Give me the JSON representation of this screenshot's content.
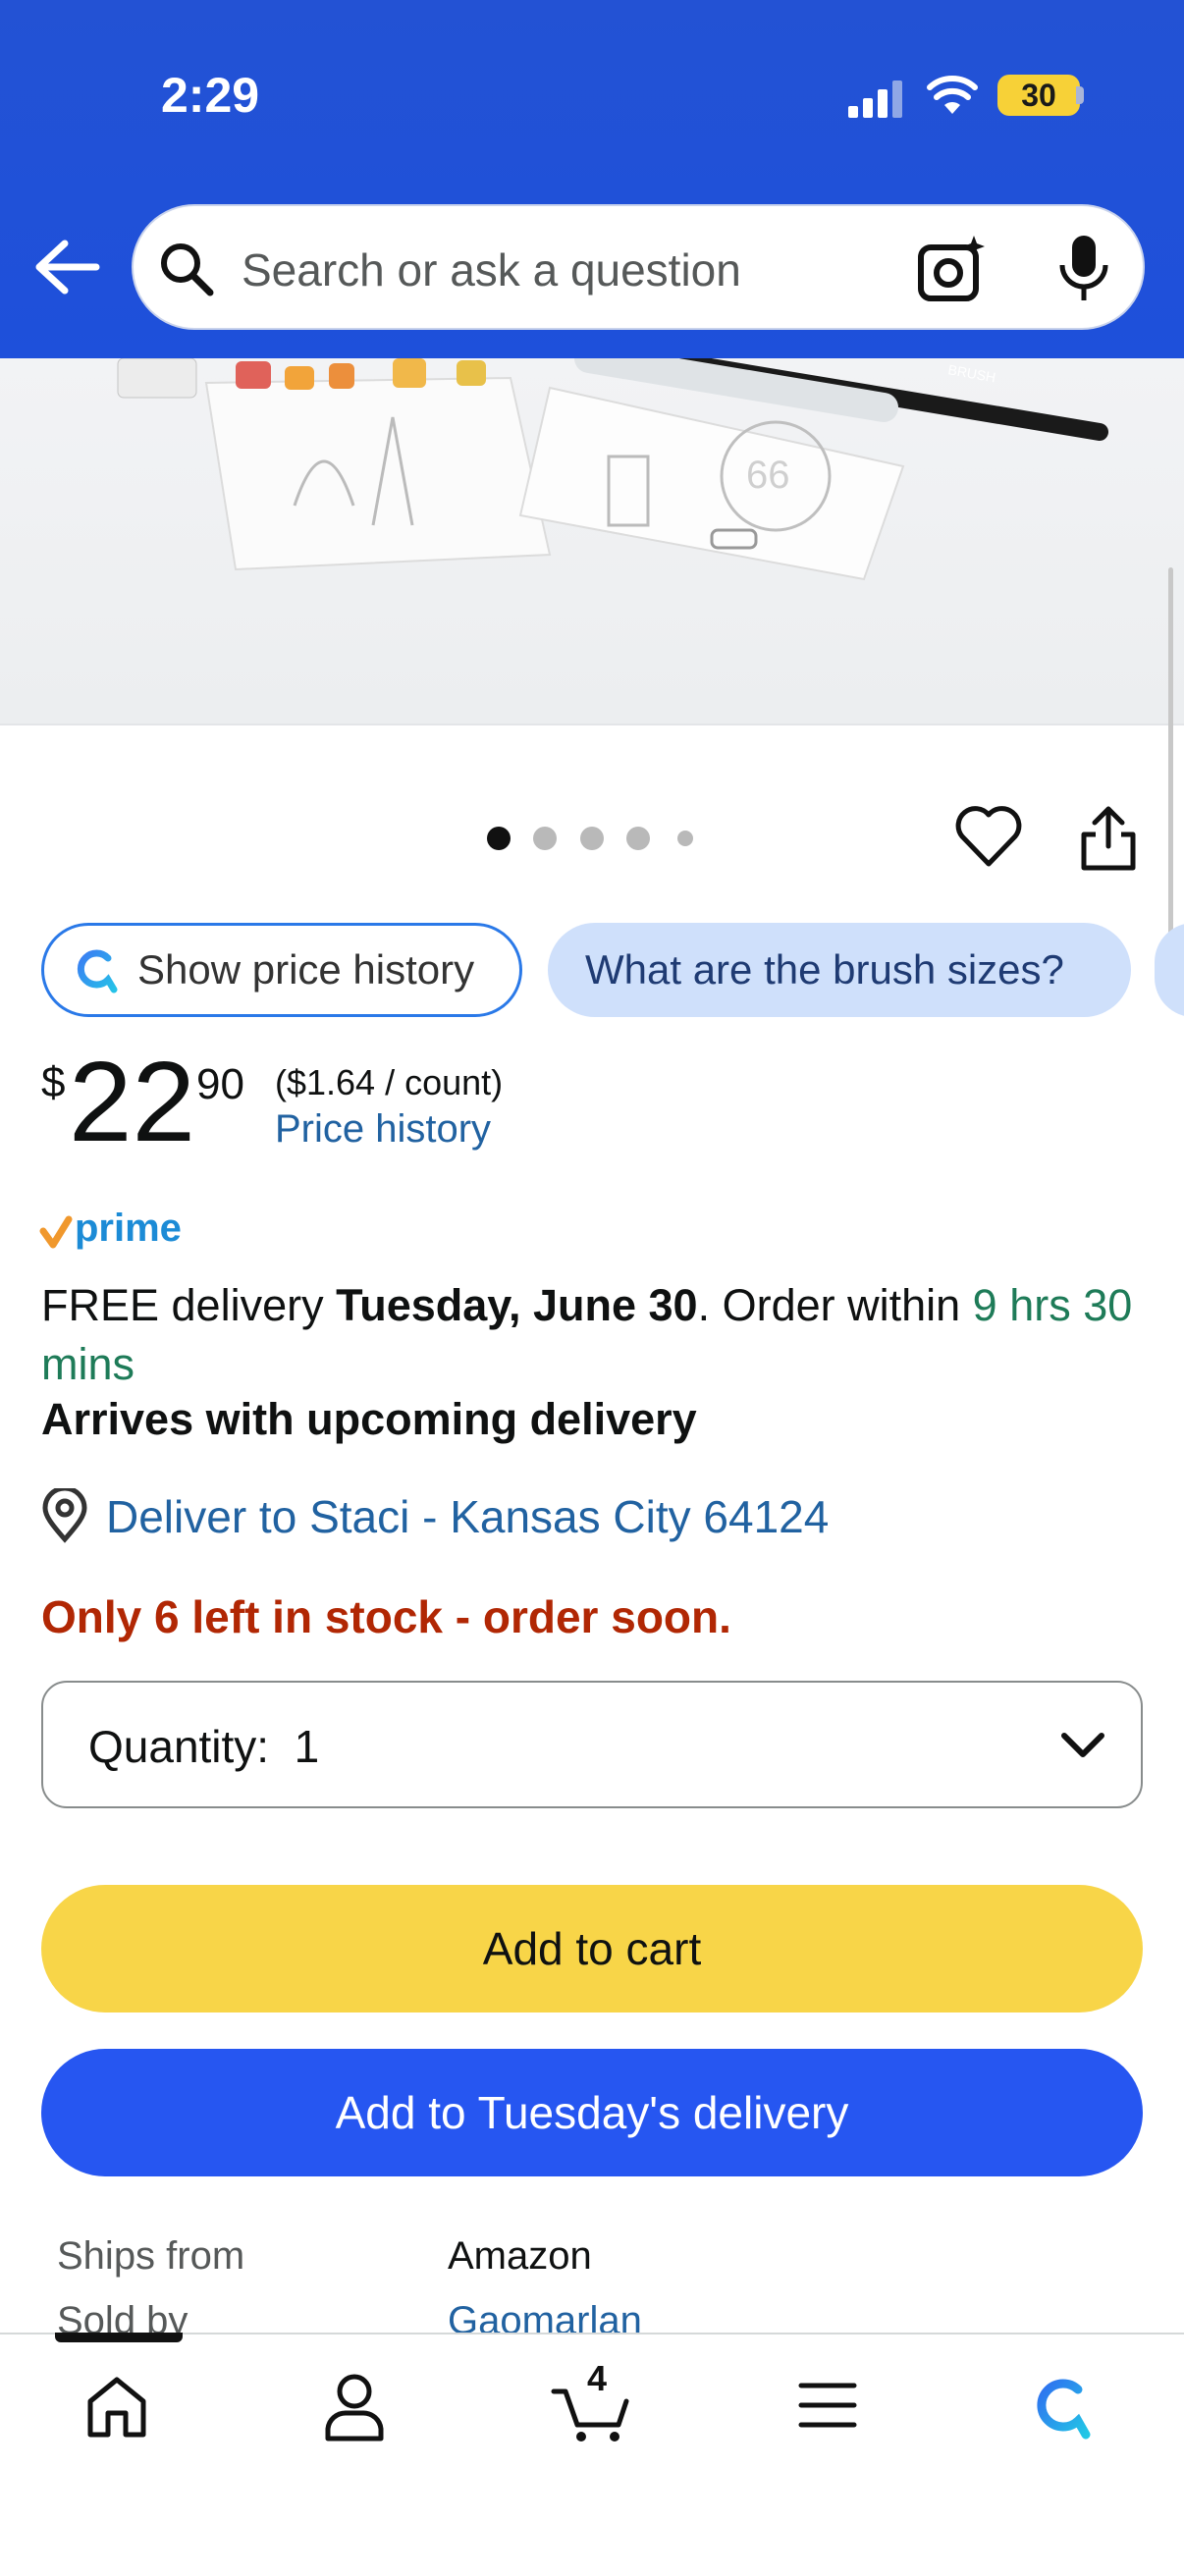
{
  "status_bar": {
    "time": "2:29",
    "battery": "30"
  },
  "search": {
    "placeholder": "Search or ask a question"
  },
  "carousel": {
    "total_images": 5,
    "current_index": 1
  },
  "chips": {
    "price_history": "Show price history",
    "question": "What are the brush sizes?"
  },
  "price": {
    "currency": "$",
    "whole": "22",
    "fraction": "90",
    "unit_price": "($1.64 / count)",
    "history_link": "Price history"
  },
  "prime": {
    "label": "prime"
  },
  "delivery": {
    "prefix": "FREE delivery ",
    "date": "Tuesday, June 30",
    "middle": ". Order within ",
    "countdown": "9 hrs 30 mins",
    "arrives": "Arrives with upcoming delivery",
    "deliver_to": "Deliver to Staci - Kansas City 64124"
  },
  "stock": {
    "message": "Only 6 left in stock - order soon."
  },
  "quantity": {
    "label": "Quantity:",
    "value": "1"
  },
  "buttons": {
    "add_to_cart": "Add to cart",
    "add_to_delivery": "Add to Tuesday's delivery"
  },
  "seller": {
    "ships_from_label": "Ships from",
    "ships_from": "Amazon",
    "sold_by_label": "Sold by",
    "sold_by": "Gaomarlan"
  },
  "bottom_nav": {
    "cart_count": "4"
  },
  "colors": {
    "header_blue": "#1e50db",
    "cart_yellow": "#f8d548",
    "delivery_blue": "#2656f1",
    "stock_red": "#b12704",
    "countdown_green": "#1e7b58",
    "link_blue": "#2162a1"
  },
  "icons": [
    "back-arrow-icon",
    "search-icon",
    "camera-search-icon",
    "microphone-icon",
    "heart-icon",
    "share-icon",
    "rufus-icon",
    "location-pin-icon",
    "chevron-down-icon",
    "home-icon",
    "account-icon",
    "cart-icon",
    "menu-icon"
  ]
}
